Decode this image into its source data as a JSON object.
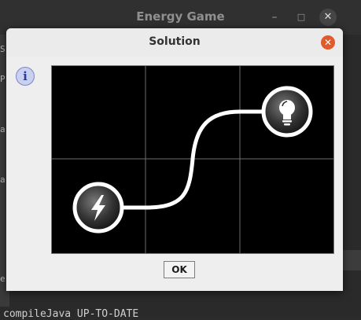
{
  "background_window": {
    "title": "Energy Game",
    "minimize_glyph": "–",
    "maximize_glyph": "□",
    "close_glyph": "✕",
    "left_edge_glyphs": [
      "S",
      "P",
      "a",
      "a",
      "e"
    ],
    "console_text": "compileJava UP-TO-DATE"
  },
  "dialog": {
    "title": "Solution",
    "close_glyph": "✕",
    "info_icon": "i",
    "ok_label": "OK"
  },
  "board": {
    "rows": 2,
    "cols": 3,
    "tiles": [
      {
        "row": 1,
        "col": 0,
        "type": "power-source",
        "icon": "lightning-icon"
      },
      {
        "row": 0,
        "col": 2,
        "type": "lamp",
        "icon": "lightbulb-icon"
      }
    ],
    "colors": {
      "background": "#000000",
      "grid": "#6e6e6e",
      "wire": "#ffffff"
    }
  }
}
